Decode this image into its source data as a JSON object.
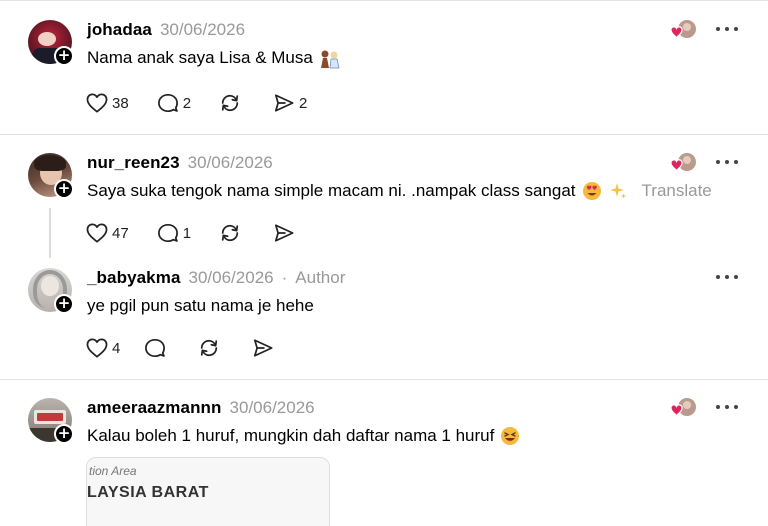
{
  "posts": [
    {
      "username": "johadaa",
      "date": "30/06/2026",
      "text": "Nama anak saya Lisa & Musa",
      "likes": "38",
      "replies": "2",
      "reposts": "",
      "shares": "2"
    },
    {
      "username": "nur_reen23",
      "date": "30/06/2026",
      "text": "Saya suka tengok nama simple macam ni. .nampak class sangat",
      "translate": "Translate",
      "likes": "47",
      "replies": "1",
      "reposts": "",
      "shares": ""
    },
    {
      "username": "_babyakma",
      "date": "30/06/2026",
      "separator": "·",
      "author_label": "Author",
      "text": "ye pgil pun satu nama je hehe",
      "likes": "4",
      "replies": "",
      "reposts": "",
      "shares": ""
    },
    {
      "username": "ameeraazmannn",
      "date": "30/06/2026",
      "text": "Kalau boleh 1 huruf, mungkin dah daftar nama 1 huruf",
      "image_text_1": "tion Area",
      "image_text_2": "LAYSIA BARAT"
    }
  ],
  "icons": {
    "like": "heart-icon",
    "reply": "comment-icon",
    "repost": "repost-icon",
    "share": "share-icon",
    "more": "more-icon",
    "follow": "plus-icon"
  },
  "colors": {
    "muted": "#999999",
    "liker_heart": "#e0245e"
  }
}
